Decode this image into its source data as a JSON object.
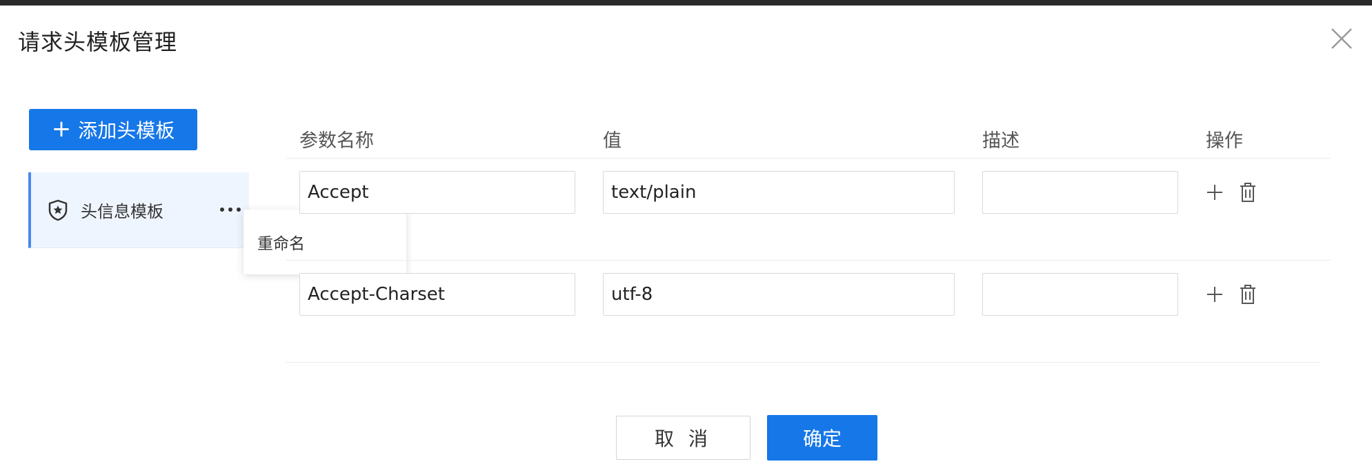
{
  "dialog": {
    "title": "请求头模板管理"
  },
  "sidebar": {
    "add_button_label": "添加头模板",
    "templates": [
      {
        "label": "头信息模板"
      }
    ],
    "context_menu": {
      "items": [
        "重命名"
      ]
    }
  },
  "table": {
    "headers": [
      "参数名称",
      "值",
      "描述",
      "操作"
    ],
    "rows": [
      {
        "name": "Accept",
        "value": "text/plain",
        "description": ""
      },
      {
        "name": "Accept-Charset",
        "value": "utf-8",
        "description": ""
      }
    ]
  },
  "footer": {
    "cancel_label": "取 消",
    "ok_label": "确定"
  },
  "colors": {
    "primary": "#1677e8",
    "selected_bg": "#eff5fe",
    "selected_border": "#4a86f0"
  },
  "icons": {
    "close": "close-icon",
    "plus": "plus-icon",
    "shield": "shield-star-icon",
    "more": "more-horizontal-icon",
    "delete": "trash-icon"
  }
}
